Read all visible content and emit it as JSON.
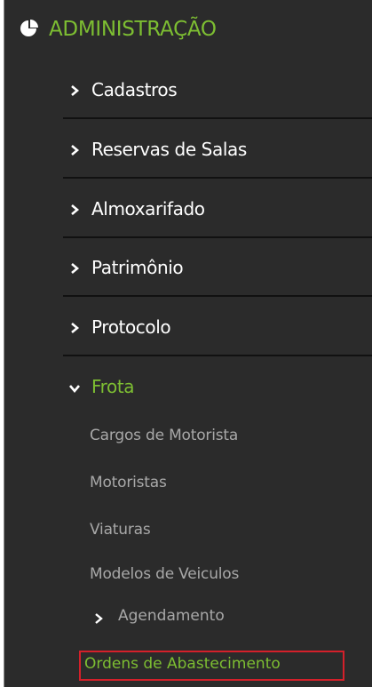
{
  "section": {
    "title": "ADMINISTRAÇÃO",
    "icon": "pie-chart-icon",
    "accent_color": "#7dbe32"
  },
  "menu": {
    "items": [
      {
        "label": "Cadastros",
        "icon": "chevron-right-icon"
      },
      {
        "label": "Reservas de Salas",
        "icon": "chevron-right-icon"
      },
      {
        "label": "Almoxarifado",
        "icon": "chevron-right-icon"
      },
      {
        "label": "Patrimônio",
        "icon": "chevron-right-icon"
      },
      {
        "label": "Protocolo",
        "icon": "chevron-right-icon"
      },
      {
        "label": "Frota",
        "icon": "chevron-down-icon",
        "expanded": true
      }
    ]
  },
  "frota": {
    "subitems": [
      {
        "label": "Cargos de Motorista"
      },
      {
        "label": "Motoristas"
      },
      {
        "label": "Viaturas"
      },
      {
        "label": "Modelos de Veiculos"
      }
    ],
    "agendamento": {
      "label": "Agendamento",
      "icon": "chevron-right-icon"
    },
    "highlighted": {
      "label": "Ordens de Abastecimento",
      "border_color": "#d4202a"
    }
  }
}
